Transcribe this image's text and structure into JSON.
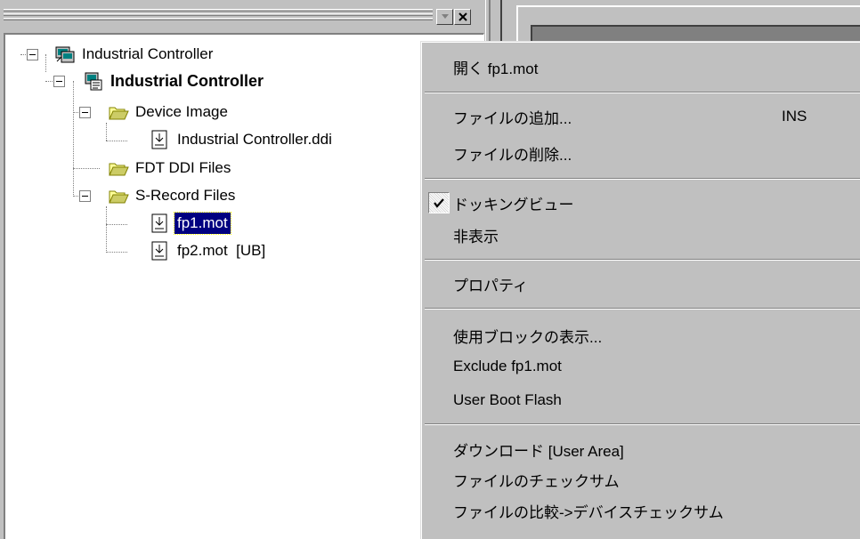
{
  "tree": {
    "root": {
      "label": "Industrial Controller",
      "icon": "project-workspace-icon"
    },
    "project": {
      "label": "Industrial Controller",
      "icon": "project-icon"
    },
    "folders": [
      {
        "label": "Device Image",
        "icon": "folder-open-icon"
      },
      {
        "label": "FDT DDI Files",
        "icon": "folder-open-icon"
      },
      {
        "label": "S-Record Files",
        "icon": "folder-open-icon"
      }
    ],
    "files": [
      {
        "label": "Industrial Controller.ddi",
        "icon": "download-file-icon"
      },
      {
        "label": "fp1.mot",
        "icon": "download-file-icon",
        "selected": true
      },
      {
        "label": "fp2.mot  [UB]",
        "icon": "download-file-icon"
      }
    ]
  },
  "context_menu": {
    "open": "開く fp1.mot",
    "add_file": "ファイルの追加...",
    "add_file_shortcut": "INS",
    "remove_file": "ファイルの削除...",
    "docking_view": "ドッキングビュー",
    "docking_view_checked": true,
    "hide": "非表示",
    "properties": "プロパティ",
    "show_used_blocks": "使用ブロックの表示...",
    "exclude": "Exclude fp1.mot",
    "user_boot_flash": "User Boot Flash",
    "download_user_area": "ダウンロード [User Area]",
    "file_checksum": "ファイルのチェックサム",
    "compare_checksum": "ファイルの比較->デバイスチェックサム"
  },
  "colors": {
    "selection_bg": "#000080",
    "face": "#c0c0c0",
    "folder_yellow": "#ffff99"
  }
}
